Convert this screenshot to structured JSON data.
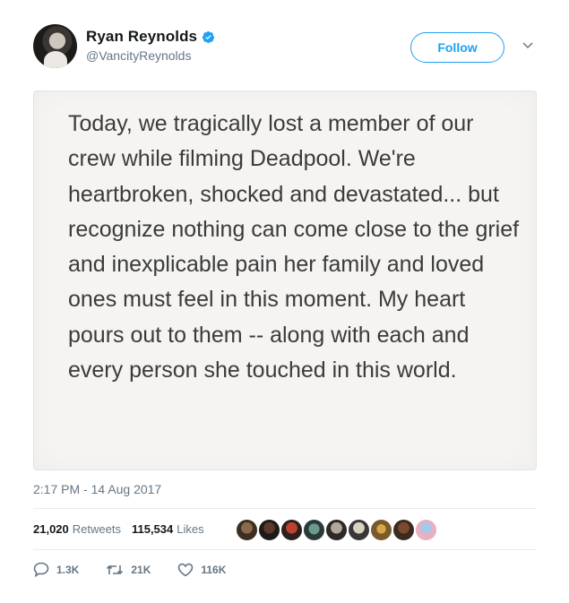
{
  "user": {
    "name": "Ryan Reynolds",
    "handle": "@VancityReynolds",
    "verified_icon": "verified-badge-icon"
  },
  "follow_label": "Follow",
  "tweet_image_text": "Today, we tragically lost a member of our crew while filming Deadpool. We're heartbroken, shocked and devastated... but recognize nothing can come close to the grief and inexplicable pain her family and loved ones must feel in this moment. My heart pours out to them -- along with each and every person she touched in this world.",
  "timestamp": "2:17 PM - 14 Aug 2017",
  "stats": {
    "retweets_count": "21,020",
    "retweets_label": "Retweets",
    "likes_count": "115,534",
    "likes_label": "Likes"
  },
  "actions": {
    "reply_count": "1.3K",
    "retweet_count": "21K",
    "like_count": "116K"
  },
  "colors": {
    "accent": "#1da1f2",
    "muted": "#657786",
    "card_bg": "#f5f4f2"
  }
}
